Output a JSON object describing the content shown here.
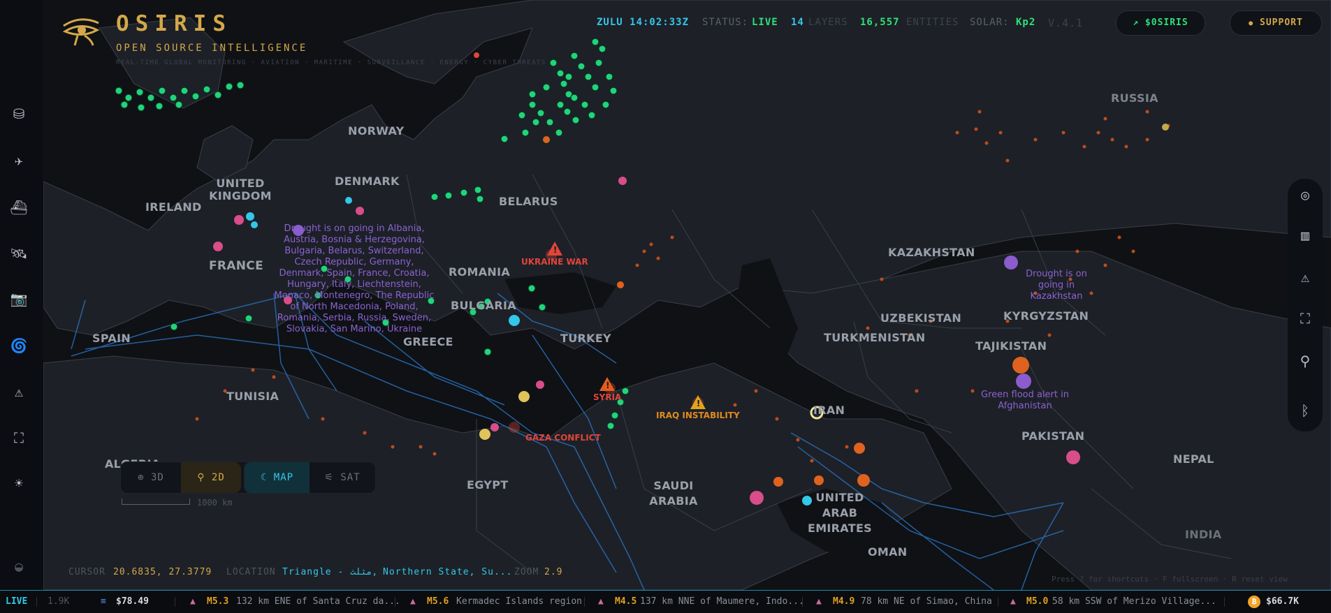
{
  "header": {
    "title": "OSIRIS",
    "subtitle": "OPEN SOURCE INTELLIGENCE",
    "tagline": "REAL-TIME GLOBAL MONITORING · AVIATION · MARITIME · SURVEILLANCE · ENERGY · CYBER THREATS",
    "zulu": "ZULU 14:02:33Z",
    "status_label": "STATUS:",
    "status_value": "LIVE",
    "layers_count": "14",
    "layers_label": "LAYERS",
    "entities_count": "16,557",
    "entities_label": "ENTITIES",
    "solar_label": "SOLAR:",
    "solar_value": "Kp2",
    "version": "V.4.1",
    "token_button": "$0SIRIS",
    "support_button": "SUPPORT"
  },
  "sidebar": {
    "items": [
      {
        "icon": "database-icon",
        "glyph": "⛁"
      },
      {
        "icon": "plane-icon",
        "glyph": "✈"
      },
      {
        "icon": "ship-icon",
        "glyph": "⛴"
      },
      {
        "icon": "satellite-icon",
        "glyph": "🛰"
      },
      {
        "icon": "camera-icon",
        "glyph": "📷"
      },
      {
        "icon": "storm-icon",
        "glyph": "🌀"
      },
      {
        "icon": "warning-icon",
        "glyph": "⚠"
      },
      {
        "icon": "network-icon",
        "glyph": "⛶"
      },
      {
        "icon": "sun-icon",
        "glyph": "☀"
      },
      {
        "icon": "ghost-icon",
        "glyph": "◒"
      }
    ]
  },
  "right_toolbar": {
    "items": [
      {
        "icon": "radar-icon",
        "glyph": "◎"
      },
      {
        "icon": "bar-chart-icon",
        "glyph": "▥"
      },
      {
        "icon": "alert-icon",
        "glyph": "⚠"
      },
      {
        "icon": "hierarchy-icon",
        "glyph": "⛶"
      },
      {
        "icon": "search-icon",
        "glyph": "⚲"
      },
      {
        "icon": "bluetooth-icon",
        "glyph": "ᛒ"
      }
    ]
  },
  "map": {
    "countries": [
      {
        "name": "NORWAY"
      },
      {
        "name": "UNITED KINGDOM"
      },
      {
        "name": "IRELAND"
      },
      {
        "name": "DENMARK"
      },
      {
        "name": "BELARUS"
      },
      {
        "name": "FRANCE"
      },
      {
        "name": "ROMANIA"
      },
      {
        "name": "BULGARIA"
      },
      {
        "name": "SPAIN"
      },
      {
        "name": "GREECE"
      },
      {
        "name": "TURKEY"
      },
      {
        "name": "TUNISIA"
      },
      {
        "name": "ALGERIA"
      },
      {
        "name": "EGYPT"
      },
      {
        "name": "SAUDI ARABIA"
      },
      {
        "name": "UNITED ARAB EMIRATES"
      },
      {
        "name": "OMAN"
      },
      {
        "name": "IRAN"
      },
      {
        "name": "KAZAKHSTAN"
      },
      {
        "name": "UZBEKISTAN"
      },
      {
        "name": "TURKMENISTAN"
      },
      {
        "name": "KYRGYZSTAN"
      },
      {
        "name": "TAJIKISTAN"
      },
      {
        "name": "PAKISTAN"
      },
      {
        "name": "NEPAL"
      },
      {
        "name": "INDIA"
      },
      {
        "name": "RUSSIA"
      }
    ],
    "hotspots": [
      {
        "name": "UKRAINE WAR",
        "color": "#e0453a"
      },
      {
        "name": "SYRIA",
        "color": "#e0453a"
      },
      {
        "name": "IRAQ INSTABILITY",
        "color": "#e08a1f"
      },
      {
        "name": "GAZA CONFLICT",
        "color": "#e0453a"
      }
    ],
    "alerts": [
      {
        "text": "Drought is on going in Albania, Austria, Bosnia & Herzegovina, Bulgaria, Belarus, Switzerland, Czech Republic, Germany, Denmark, Spain, France, Croatia, Hungary, Italy, Liechtenstein, Monaco, Montenegro, The Republic of North Macedonia, Poland, Romania, Serbia, Russia, Sweden, Slovakia, San Marino, Ukraine"
      },
      {
        "text": "Drought is on going in Kazakhstan"
      },
      {
        "text": "Green flood alert in Afghanistan"
      }
    ]
  },
  "view_controls": {
    "globe_3d": "3D",
    "flat_2d": "2D",
    "map": "MAP",
    "sat": "SAT",
    "scale_label": "1000 km"
  },
  "status_bar": {
    "cursor_label": "CURSOR",
    "cursor_value": "20.6835, 27.3779",
    "location_label": "LOCATION",
    "location_value": "Triangle - مثلث, Northern State, Su...",
    "zoom_label": "ZOOM",
    "zoom_value": "2.9",
    "hints": "Press ? for shortcuts · F fullscreen · R reset view"
  },
  "ticker": {
    "live": "LIVE",
    "items": [
      {
        "text": "1.9K"
      },
      {
        "label": "$78.49",
        "icon": "eth-icon"
      },
      {
        "mag": "M5.3",
        "text": "132 km ENE of Santa Cruz da..."
      },
      {
        "mag": "M5.6",
        "text": "Kermadec Islands region"
      },
      {
        "mag": "M4.5",
        "text": "137 km NNE of Maumere, Indo..."
      },
      {
        "mag": "M4.9",
        "text": "78 km NE of Simao, China"
      },
      {
        "mag": "M5.0",
        "text": "58 km SSW of Merizo Village..."
      },
      {
        "label": "$66.7K",
        "icon": "btc-icon"
      }
    ]
  },
  "colors": {
    "accent_gold": "#d4a84a",
    "live_green": "#2ee07a",
    "cyan": "#33c7e8",
    "ship_green": "#22d37a",
    "fire_orange": "#e0621f",
    "hazard_red": "#e0453a"
  }
}
